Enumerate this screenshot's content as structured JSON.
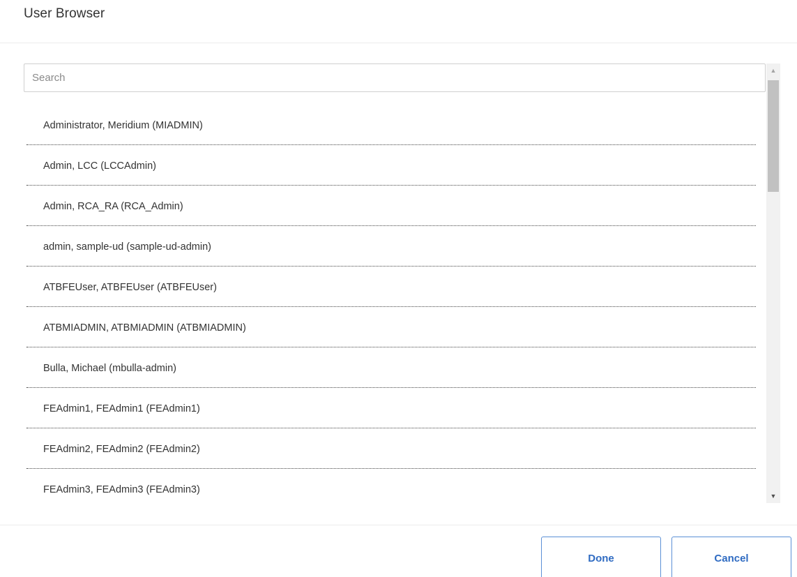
{
  "dialog": {
    "title": "User Browser"
  },
  "search": {
    "placeholder": "Search",
    "value": ""
  },
  "users": [
    {
      "label": "Administrator, Meridium (MIADMIN)"
    },
    {
      "label": "Admin, LCC (LCCAdmin)"
    },
    {
      "label": "Admin, RCA_RA (RCA_Admin)"
    },
    {
      "label": "admin, sample-ud (sample-ud-admin)"
    },
    {
      "label": "ATBFEUser, ATBFEUser (ATBFEUser)"
    },
    {
      "label": "ATBMIADMIN, ATBMIADMIN (ATBMIADMIN)"
    },
    {
      "label": "Bulla, Michael (mbulla-admin)"
    },
    {
      "label": "FEAdmin1, FEAdmin1 (FEAdmin1)"
    },
    {
      "label": "FEAdmin2, FEAdmin2 (FEAdmin2)"
    },
    {
      "label": "FEAdmin3, FEAdmin3 (FEAdmin3)"
    }
  ],
  "footer": {
    "done_label": "Done",
    "cancel_label": "Cancel"
  },
  "icons": {
    "scroll_up": "triangle-up-icon",
    "scroll_down": "triangle-down-icon"
  },
  "colors": {
    "accent": "#2f6bc2",
    "button_border": "#5b8fd6"
  }
}
